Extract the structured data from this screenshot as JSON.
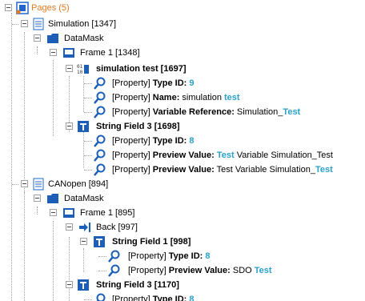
{
  "root": {
    "label": "Pages (5)"
  },
  "items": {
    "simulation": {
      "label": "Simulation [1347]"
    },
    "datamask1": {
      "label": "DataMask"
    },
    "frame1": {
      "label": "Frame 1 [1348]"
    },
    "simtest": {
      "label": "simulation test [1697]"
    },
    "p1": {
      "prefix": "[Property] ",
      "key": "Type ID:",
      "val_plain": " ",
      "val_hl": "9",
      "tail": ""
    },
    "p2": {
      "prefix": "[Property] ",
      "key": "Name:",
      "val_plain": " simulation ",
      "val_hl": "test",
      "tail": ""
    },
    "p3": {
      "prefix": "[Property] ",
      "key": "Variable Reference:",
      "val_plain": " Simulation_",
      "val_hl": "Test",
      "tail": ""
    },
    "sf3a": {
      "label": "String Field 3 [1698]"
    },
    "p4": {
      "prefix": "[Property] ",
      "key": "Type ID:",
      "val_plain": " ",
      "val_hl": "8",
      "tail": ""
    },
    "p5": {
      "prefix": "[Property] ",
      "key": "Preview Value:",
      "val_plain": " ",
      "val_hl": "Test",
      "tail": " Variable Simulation_Test"
    },
    "p6": {
      "prefix": "[Property] ",
      "key": "Preview Value:",
      "val_plain": " Test Variable Simulation_",
      "val_hl": "Test",
      "tail": ""
    },
    "canopen": {
      "label": "CANopen [894]"
    },
    "datamask2": {
      "label": "DataMask"
    },
    "frame2": {
      "label": "Frame 1 [895]"
    },
    "back": {
      "label": "Back [997]"
    },
    "sf1": {
      "label": "String Field 1 [998]"
    },
    "p7": {
      "prefix": "[Property] ",
      "key": "Type ID:",
      "val_plain": " ",
      "val_hl": "8",
      "tail": ""
    },
    "p8": {
      "prefix": "[Property] ",
      "key": "Preview Value:",
      "val_plain": " SDO ",
      "val_hl": "Test",
      "tail": ""
    },
    "sf3b": {
      "label": "String Field 3 [1170]"
    },
    "p9": {
      "prefix": "[Property] ",
      "key": "Type ID:",
      "val_plain": " ",
      "val_hl": "8",
      "tail": ""
    }
  }
}
